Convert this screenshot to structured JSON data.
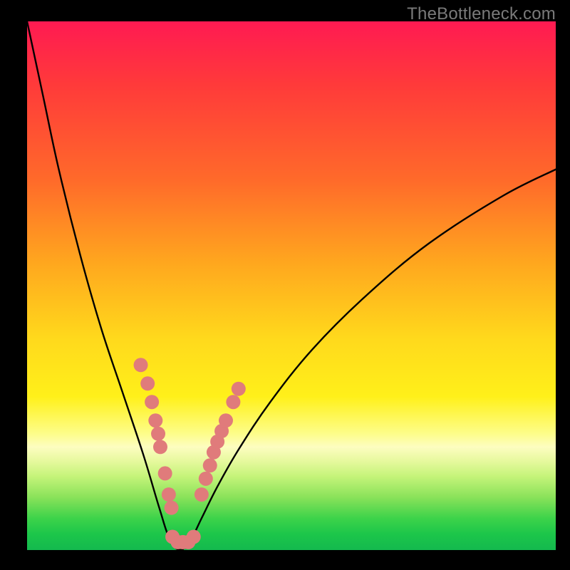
{
  "watermark": "TheBottleneck.com",
  "chart_data": {
    "type": "line",
    "title": "",
    "xlabel": "",
    "ylabel": "",
    "xlim": [
      0,
      100
    ],
    "ylim": [
      0,
      100
    ],
    "background_gradient": {
      "top_color": "#ff1a52",
      "mid_color": "#fff01a",
      "bottom_color": "#14b94e"
    },
    "curve": {
      "description": "V-shaped bottleneck curve; high at both ends, near zero at the minimum",
      "minimum_x": 29,
      "points_x": [
        0,
        3,
        6,
        10,
        14,
        18,
        22,
        25,
        27,
        29,
        31,
        33,
        36,
        40,
        46,
        54,
        64,
        76,
        90,
        100
      ],
      "points_y": [
        100,
        86,
        72,
        56,
        42,
        30,
        18,
        8,
        2,
        0,
        2,
        6,
        12,
        19,
        28,
        38,
        48,
        58,
        67,
        72
      ]
    },
    "highlight_dots": {
      "color": "#e07b7b",
      "left_branch": [
        {
          "x": 21.5,
          "y": 35.0
        },
        {
          "x": 22.8,
          "y": 31.5
        },
        {
          "x": 23.6,
          "y": 28.0
        },
        {
          "x": 24.3,
          "y": 24.5
        },
        {
          "x": 24.8,
          "y": 22.0
        },
        {
          "x": 25.2,
          "y": 19.5
        },
        {
          "x": 26.1,
          "y": 14.5
        },
        {
          "x": 26.8,
          "y": 10.5
        },
        {
          "x": 27.3,
          "y": 8.0
        }
      ],
      "right_branch": [
        {
          "x": 33.0,
          "y": 10.5
        },
        {
          "x": 33.8,
          "y": 13.5
        },
        {
          "x": 34.6,
          "y": 16.0
        },
        {
          "x": 35.3,
          "y": 18.5
        },
        {
          "x": 36.0,
          "y": 20.5
        },
        {
          "x": 36.8,
          "y": 22.5
        },
        {
          "x": 37.6,
          "y": 24.5
        },
        {
          "x": 39.0,
          "y": 28.0
        },
        {
          "x": 40.0,
          "y": 30.5
        }
      ],
      "bottom_cluster": [
        {
          "x": 27.5,
          "y": 2.5
        },
        {
          "x": 28.5,
          "y": 1.5
        },
        {
          "x": 29.5,
          "y": 1.5
        },
        {
          "x": 30.5,
          "y": 1.5
        },
        {
          "x": 31.5,
          "y": 2.5
        }
      ]
    }
  }
}
